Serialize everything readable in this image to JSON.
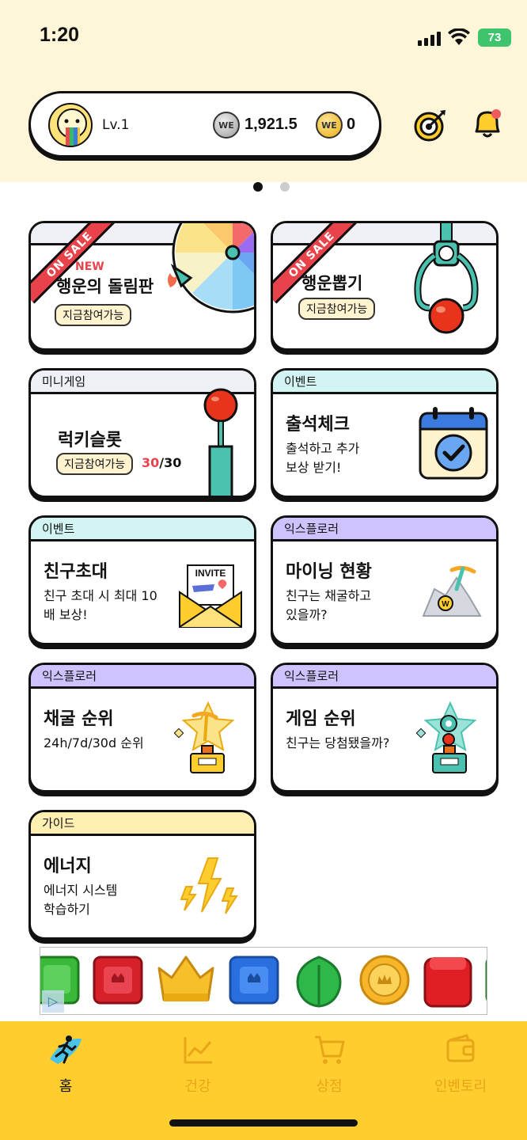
{
  "status": {
    "time": "1:20",
    "battery": "73"
  },
  "profile": {
    "level": "Lv.1",
    "silver_amount": "1,921.5",
    "gold_amount": "0",
    "coin_symbol": "WE"
  },
  "cards": {
    "lucky_wheel": {
      "badge": "ON SALE",
      "new_tag": "NEW",
      "title": "행운의 돌림판",
      "pill": "지금참여가능"
    },
    "lucky_draw": {
      "badge": "ON SALE",
      "title": "행운뽑기",
      "pill": "지금참여가능"
    },
    "lucky_slot": {
      "tag": "미니게임",
      "title": "럭키슬롯",
      "pill": "지금참여가능",
      "count_used": "30",
      "count_total": "/30"
    },
    "attendance": {
      "tag": "이벤트",
      "title": "출석체크",
      "desc_line1": "출석하고 추가",
      "desc_line2": "보상 받기!"
    },
    "invite": {
      "tag": "이벤트",
      "title": "친구초대",
      "desc_line1": "친구 초대 시 최대 10",
      "desc_line2": "배 보상!",
      "illus_label": "INVITE"
    },
    "mining_status": {
      "tag": "익스플로러",
      "title": "마이닝 현황",
      "desc_line1": "친구는 채굴하고",
      "desc_line2": "있을까?"
    },
    "mining_rank": {
      "tag": "익스플로러",
      "title": "채굴 순위",
      "desc_line1": "24h/7d/30d 순위"
    },
    "game_rank": {
      "tag": "익스플로러",
      "title": "게임 순위",
      "desc_line1": "친구는 당첨됐을까?"
    },
    "energy": {
      "tag": "가이드",
      "title": "에너지",
      "desc_line1": "에너지 시스템",
      "desc_line2": "학습하기"
    }
  },
  "tag_colors": {
    "mini_game": "#EEF0F6",
    "event": "#D2F5F3",
    "explorer": "#CFC2FF",
    "guide": "#FFEFB0"
  },
  "accent": {
    "nav_bg": "#FFCD2E",
    "top_bg": "#FFF6DA",
    "sale_red": "#E8434B",
    "count_red": "#E8434B"
  },
  "nav": [
    {
      "label": "홈",
      "icon": "running-person-icon",
      "active": true
    },
    {
      "label": "건강",
      "icon": "chart-icon",
      "active": false
    },
    {
      "label": "상점",
      "icon": "cart-icon",
      "active": false
    },
    {
      "label": "인벤토리",
      "icon": "wallet-icon",
      "active": false
    }
  ]
}
